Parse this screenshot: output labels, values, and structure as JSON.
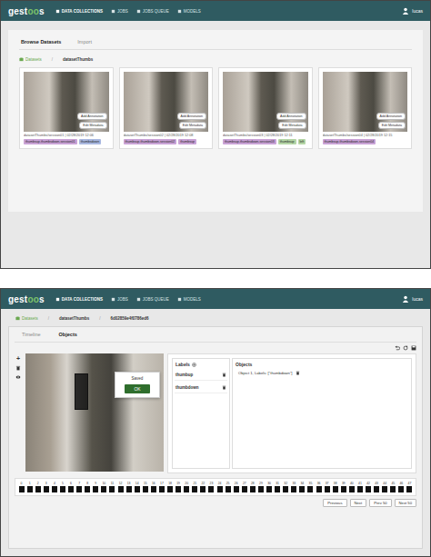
{
  "app": {
    "logo": [
      {
        "text": "gest",
        "accent": false
      },
      {
        "text": "oo",
        "accent": true
      },
      {
        "text": "s",
        "accent": false
      }
    ],
    "nav": [
      {
        "label": "DATA COLLECTIONS",
        "selected": true
      },
      {
        "label": "JOBS",
        "selected": false
      },
      {
        "label": "JOBS QUEUE",
        "selected": false
      },
      {
        "label": "MODELS",
        "selected": false
      }
    ],
    "user": "lucas"
  },
  "browse": {
    "tabs": [
      {
        "label": "Browse Datasets",
        "selected": true
      },
      {
        "label": "Import",
        "selected": false
      }
    ],
    "breadcrumb": [
      {
        "label": "Datasets",
        "link": true
      },
      {
        "label": "datasetThumbs",
        "link": false
      }
    ],
    "cards": [
      {
        "filename": "datasetThumbs/session01 | 02/28/2019 12:06",
        "actions": [
          "Add Annotation",
          "Edit Metadata"
        ],
        "tags": [
          {
            "label": "thumbsup-thumbsdown-session01",
            "color": "#c9a2d6"
          },
          {
            "label": "thumbsdown",
            "color": "#a9b8e0"
          }
        ]
      },
      {
        "filename": "datasetThumbs/session02 | 02/28/2019 12:08",
        "actions": [
          "Add Annotation",
          "Edit Metadata"
        ],
        "tags": [
          {
            "label": "thumbsup-thumbsdown-session02",
            "color": "#c9a2d6"
          },
          {
            "label": "thumbsup",
            "color": "#c9a2d6"
          }
        ]
      },
      {
        "filename": "datasetThumbs/session03 | 02/28/2019 12:11",
        "actions": [
          "Add Annotation",
          "Edit Metadata"
        ],
        "tags": [
          {
            "label": "thumbsup-thumbsdown-session03",
            "color": "#c9a2d6"
          },
          {
            "label": "thumbsup",
            "color": "#b5d6a6"
          },
          {
            "label": "left",
            "color": "#b5d6a6"
          }
        ]
      },
      {
        "filename": "datasetThumbs/session04 | 02/28/2019 12:15",
        "actions": [
          "Add Annotation",
          "Edit Metadata"
        ],
        "tags": [
          {
            "label": "thumbsup-thumbsdown-session04",
            "color": "#c9a2d6"
          }
        ]
      }
    ]
  },
  "editor": {
    "breadcrumb": [
      {
        "label": "Datasets",
        "link": true
      },
      {
        "label": "datasetThumbs",
        "link": false
      },
      {
        "label": "6d02859e4f0786ed6",
        "link": false
      }
    ],
    "tabs": [
      {
        "label": "Timeline",
        "selected": false
      },
      {
        "label": "Objects",
        "selected": true
      }
    ],
    "tools": [
      "+"
    ],
    "dialog": {
      "title": "Saved",
      "button": "OK"
    },
    "labels": {
      "title": "Labels",
      "items": [
        "thumbup",
        "thumbdown"
      ]
    },
    "objects": {
      "title": "Objects",
      "items": [
        "Object 1, Labels: [\"thumbdown\"]"
      ]
    },
    "frames": [
      "0",
      "1",
      "2",
      "3",
      "4",
      "5",
      "6",
      "7",
      "8",
      "9",
      "10",
      "11",
      "12",
      "13",
      "14",
      "15",
      "16",
      "17",
      "18",
      "19",
      "20",
      "21",
      "22",
      "23",
      "24",
      "25",
      "26",
      "27",
      "28",
      "29",
      "30",
      "31",
      "32",
      "33",
      "34",
      "35",
      "36",
      "37",
      "38",
      "39",
      "40",
      "41",
      "42",
      "43",
      "44",
      "45",
      "46",
      "47"
    ],
    "pager": [
      "Previous",
      "Next",
      "Prev 50",
      "Next 50"
    ]
  }
}
